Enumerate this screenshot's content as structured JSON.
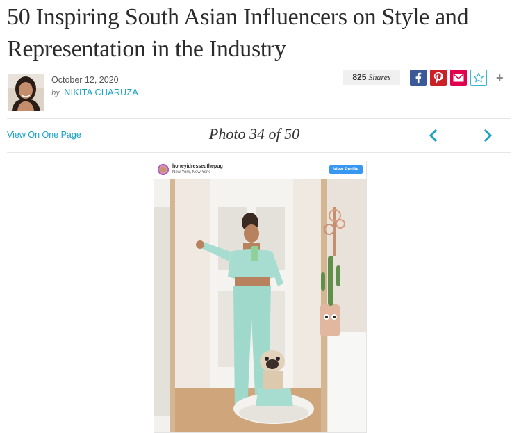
{
  "article": {
    "title": "50 Inspiring South Asian Influencers on Style and Representation in the Industry",
    "date": "October 12, 2020",
    "by_word": "by",
    "author": "NIKITA CHARUZA"
  },
  "share": {
    "count": "825",
    "count_label": "Shares",
    "more_label": "+"
  },
  "gallery": {
    "view_one_page": "View On One Page",
    "counter": "Photo 34 of 50"
  },
  "instagram": {
    "username": "honeyidressedthepug",
    "location": "New York, New York",
    "view_profile": "View Profile"
  },
  "colors": {
    "accent": "#1aa3c4",
    "facebook": "#3b5998",
    "pinterest": "#cb2027",
    "email": "#e0004d",
    "instagram_blue": "#3897f0"
  },
  "icons": [
    "facebook-icon",
    "pinterest-icon",
    "email-icon",
    "star-icon",
    "chevron-left-icon",
    "chevron-right-icon"
  ]
}
